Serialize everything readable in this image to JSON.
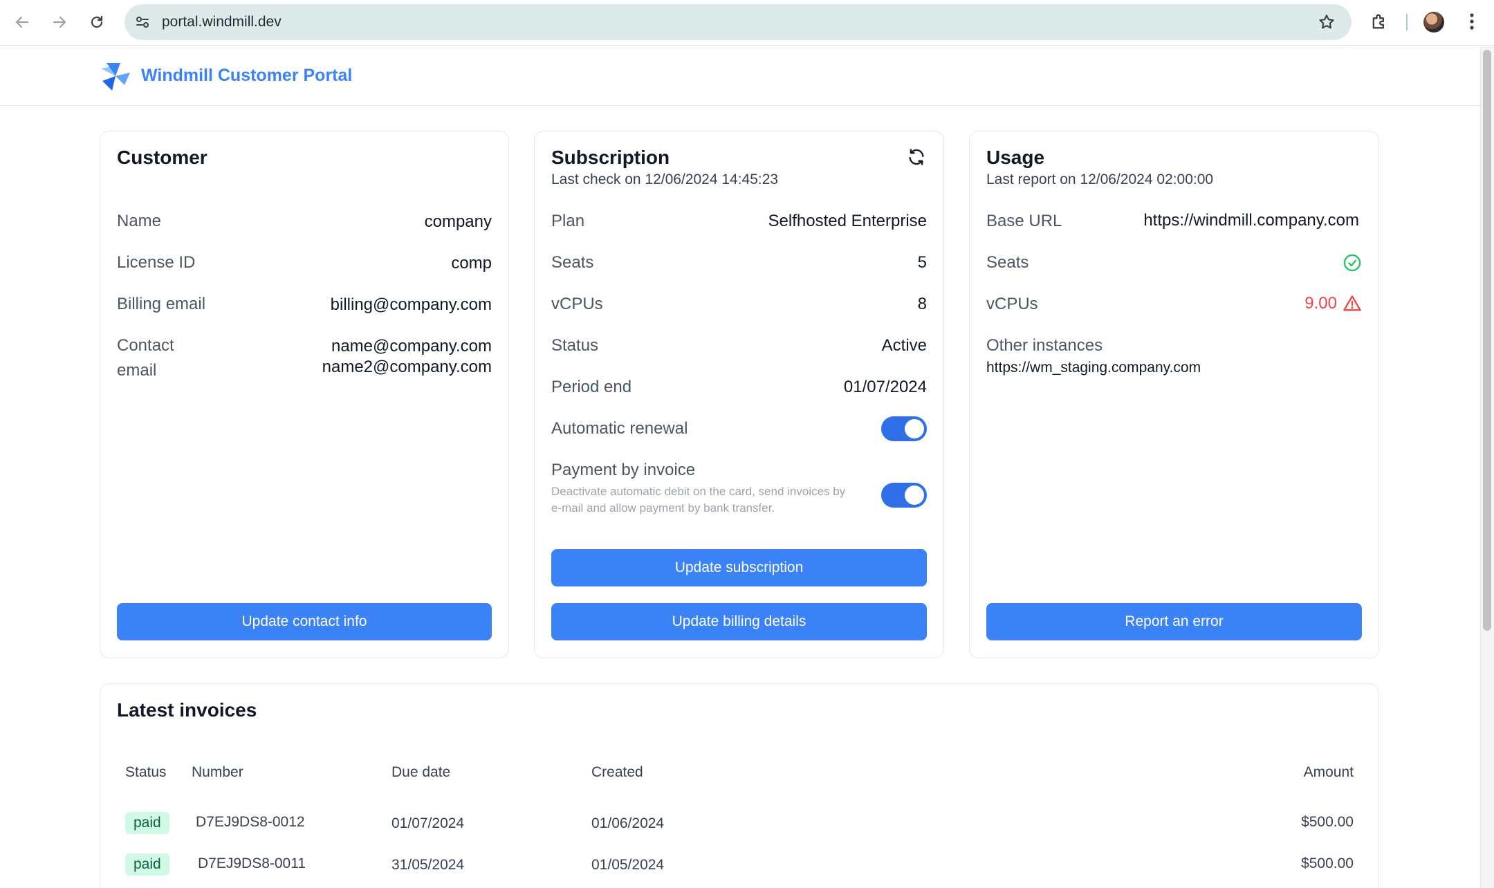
{
  "browser": {
    "url": "portal.windmill.dev"
  },
  "header": {
    "brand": "Windmill Customer Portal"
  },
  "customer": {
    "title": "Customer",
    "rows": [
      {
        "label": "Name",
        "value": "company"
      },
      {
        "label": "License ID",
        "value": "comp"
      },
      {
        "label": "Billing email",
        "value": "billing@company.com"
      }
    ],
    "contact_label_line1": "Contact",
    "contact_label_line2": "email",
    "contact_emails": [
      "name@company.com",
      "name2@company.com"
    ],
    "button": "Update contact info"
  },
  "subscription": {
    "title": "Subscription",
    "last_check": "Last check on 12/06/2024 14:45:23",
    "rows": [
      {
        "label": "Plan",
        "value": "Selfhosted Enterprise"
      },
      {
        "label": "Seats",
        "value": "5"
      },
      {
        "label": "vCPUs",
        "value": "8"
      },
      {
        "label": "Status",
        "value": "Active"
      },
      {
        "label": "Period end",
        "value": "01/07/2024"
      }
    ],
    "auto_renewal_label": "Automatic renewal",
    "auto_renewal_on": true,
    "invoice_label": "Payment by invoice",
    "invoice_desc": "Deactivate automatic debit on the card, send invoices by e-mail and allow payment by bank transfer.",
    "invoice_on": true,
    "update_subscription_button": "Update subscription",
    "update_billing_button": "Update billing details"
  },
  "usage": {
    "title": "Usage",
    "last_report": "Last report on 12/06/2024 02:00:00",
    "base_url_label": "Base URL",
    "base_url_value": "https://windmill.company.com",
    "seats_label": "Seats",
    "vcpus_label": "vCPUs",
    "vcpus_value": "9.00",
    "other_instances_label": "Other instances",
    "other_instances": [
      "https://wm_staging.company.com"
    ],
    "button": "Report an error",
    "ok_color": "#22c55e",
    "warn_color": "#ef4444"
  },
  "invoices": {
    "title": "Latest invoices",
    "columns": [
      "Status",
      "Number",
      "Due date",
      "Created",
      "Amount"
    ],
    "rows": [
      {
        "status": "paid",
        "number": "D7EJ9DS8-0012",
        "due": "01/07/2024",
        "created": "01/06/2024",
        "amount": "$500.00"
      },
      {
        "status": "paid",
        "number": "D7EJ9DS8-0011",
        "due": "31/05/2024",
        "created": "01/05/2024",
        "amount": "$500.00"
      }
    ]
  },
  "accent_color": "#3b82f6"
}
